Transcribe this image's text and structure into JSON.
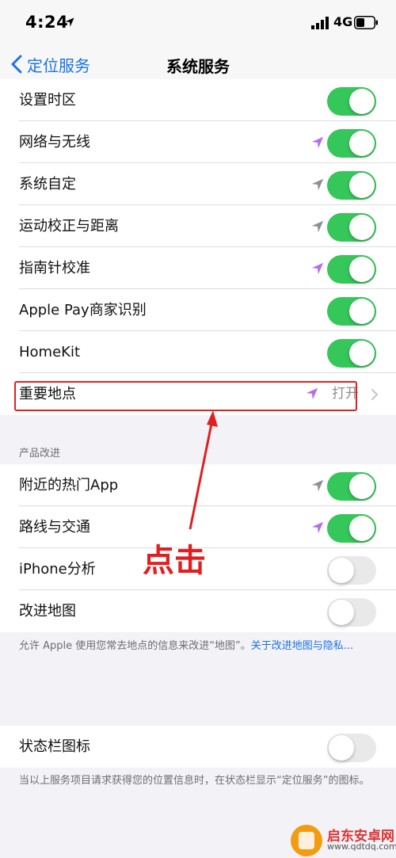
{
  "status_bar": {
    "time": "4:24",
    "network": "4G"
  },
  "nav": {
    "back_label": "定位服务",
    "title": "系统服务"
  },
  "group1": {
    "rows": [
      {
        "label": "设置时区",
        "toggle": true
      },
      {
        "label": "网络与无线",
        "toggle": true,
        "location_arrow": "purple"
      },
      {
        "label": "系统自定",
        "toggle": true,
        "location_arrow": "gray"
      },
      {
        "label": "运动校正与距离",
        "toggle": true,
        "location_arrow": "gray"
      },
      {
        "label": "指南针校准",
        "toggle": true,
        "location_arrow": "purple"
      },
      {
        "label": "Apple Pay商家识别",
        "toggle": true
      },
      {
        "label": "HomeKit",
        "toggle": true
      },
      {
        "label": "重要地点",
        "value": "打开",
        "location_arrow": "purple"
      }
    ]
  },
  "section2": {
    "header": "产品改进",
    "rows": [
      {
        "label": "附近的热门App",
        "toggle": true,
        "location_arrow": "gray"
      },
      {
        "label": "路线与交通",
        "toggle": true,
        "location_arrow": "purple"
      },
      {
        "label": "iPhone分析",
        "toggle": false
      },
      {
        "label": "改进地图",
        "toggle": false
      }
    ],
    "footnote_text": "允许 Apple 使用您常去地点的信息来改进“地图”。",
    "footnote_link": "关于改进地图与隐私..."
  },
  "section3": {
    "rows": [
      {
        "label": "状态栏图标",
        "toggle": false
      }
    ],
    "footnote": "当以上服务项目请求获得您的位置信息时，在状态栏显示“定位服务”的图标。"
  },
  "annotation": {
    "text": "点击",
    "color": "#e02020"
  },
  "watermark": {
    "title": "启东安卓网",
    "subtitle": "www.qdtdq.com"
  },
  "colors": {
    "toggle_on": "#35c759",
    "accent": "#1a73e8",
    "location_purple": "#b36ef0"
  }
}
